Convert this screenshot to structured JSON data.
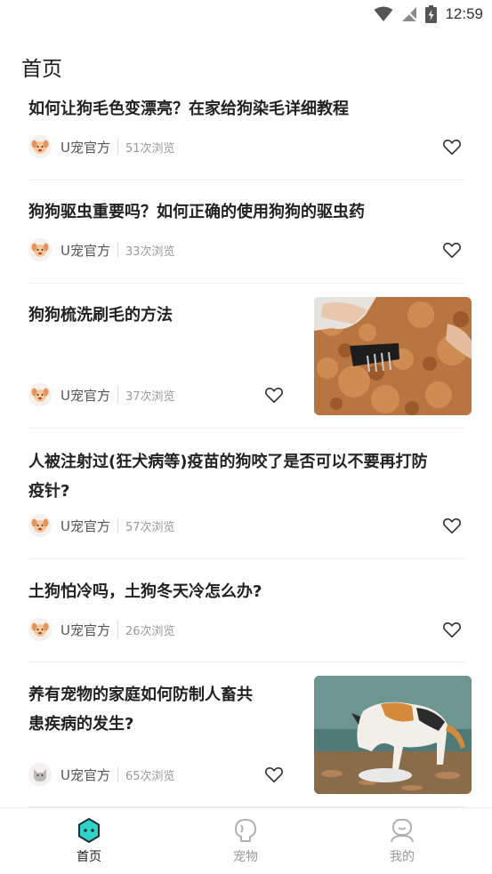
{
  "status_bar": {
    "time": "12:59"
  },
  "header": {
    "title": "首页"
  },
  "feed": {
    "items": [
      {
        "title_lines": [
          "如何让狗毛色变漂亮？在家给狗染毛详细教程"
        ],
        "author": "U宠官方",
        "views": "51次浏览",
        "has_image": false,
        "avatar": "dog"
      },
      {
        "title_lines": [
          "狗狗驱虫重要吗？如何正确的使用狗狗的驱虫药"
        ],
        "author": "U宠官方",
        "views": "33次浏览",
        "has_image": false,
        "avatar": "dog"
      },
      {
        "title_lines": [
          "狗狗梳洗刷毛的方法"
        ],
        "author": "U宠官方",
        "views": "37次浏览",
        "has_image": true,
        "image": "dog-grooming-photo",
        "avatar": "dog"
      },
      {
        "title_lines": [
          "人被注射过(狂犬病等)疫苗的狗咬了是否可以不要再打防",
          "疫针?"
        ],
        "author": "U宠官方",
        "views": "57次浏览",
        "has_image": false,
        "avatar": "dog"
      },
      {
        "title_lines": [
          "土狗怕冷吗，土狗冬天冷怎么办?"
        ],
        "author": "U宠官方",
        "views": "26次浏览",
        "has_image": false,
        "avatar": "dog"
      },
      {
        "title_lines": [
          "养有宠物的家庭如何防制人畜共",
          "患疾病的发生?"
        ],
        "author": "U宠官方",
        "views": "65次浏览",
        "has_image": true,
        "image": "calico-cat-photo",
        "avatar": "cat"
      }
    ]
  },
  "tabbar": {
    "tabs": [
      {
        "label": "首页",
        "icon": "home-hexagon-icon",
        "active": true
      },
      {
        "label": "宠物",
        "icon": "pet-icon",
        "active": false
      },
      {
        "label": "我的",
        "icon": "profile-icon",
        "active": false
      }
    ],
    "accent": "#2ed3c7"
  }
}
